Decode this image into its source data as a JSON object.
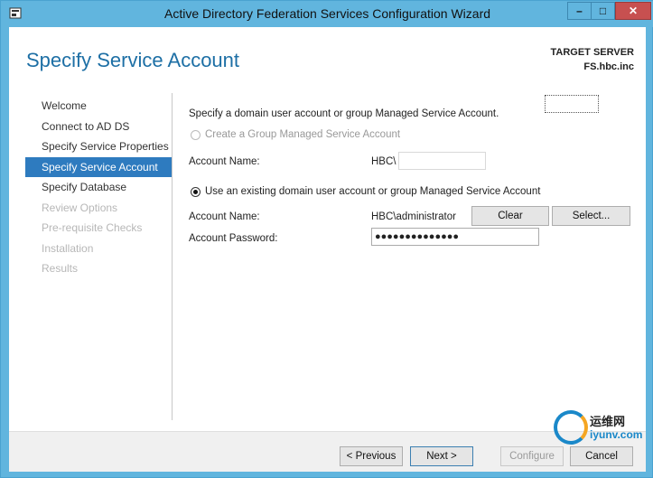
{
  "window": {
    "title": "Active Directory Federation Services Configuration Wizard"
  },
  "header": {
    "title": "Specify Service Account",
    "target_label": "TARGET SERVER",
    "target_value": "FS.hbc.inc"
  },
  "nav": {
    "items": [
      {
        "label": "Welcome",
        "state": "normal"
      },
      {
        "label": "Connect to AD DS",
        "state": "normal"
      },
      {
        "label": "Specify Service Properties",
        "state": "normal"
      },
      {
        "label": "Specify Service Account",
        "state": "active"
      },
      {
        "label": "Specify Database",
        "state": "normal"
      },
      {
        "label": "Review Options",
        "state": "disabled"
      },
      {
        "label": "Pre-requisite Checks",
        "state": "disabled"
      },
      {
        "label": "Installation",
        "state": "disabled"
      },
      {
        "label": "Results",
        "state": "disabled"
      }
    ]
  },
  "main": {
    "intro": "Specify a domain user account or group Managed Service Account.",
    "gmsa_option": "Create a Group Managed Service Account",
    "gmsa_account_label": "Account Name:",
    "gmsa_domain_prefix": "HBC\\",
    "gmsa_account_value": "",
    "existing_option": "Use an existing domain user account or group Managed Service Account",
    "existing_account_label": "Account Name:",
    "existing_account_value": "HBC\\administrator",
    "clear_button": "Clear",
    "select_button": "Select...",
    "password_label": "Account Password:",
    "password_value": "●●●●●●●●●●●●●●"
  },
  "footer": {
    "previous": "< Previous",
    "next": "Next >",
    "configure": "Configure",
    "cancel": "Cancel"
  },
  "watermark": {
    "line1": "运维网",
    "line2": "iyunv.com"
  },
  "colors": {
    "accent": "#2e7bbf",
    "title_blue": "#1d6fa5",
    "frame": "#61b5de"
  }
}
